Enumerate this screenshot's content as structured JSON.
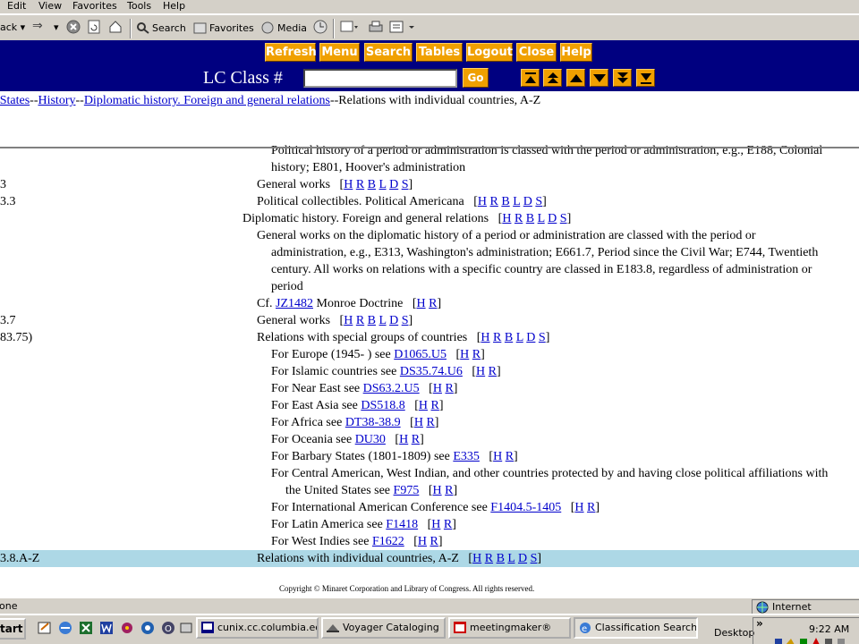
{
  "menubar": {
    "items": [
      "Edit",
      "View",
      "Favorites",
      "Tools",
      "Help"
    ]
  },
  "toolbar": {
    "back": "ack",
    "search": "Search",
    "favorites": "Favorites",
    "media": "Media"
  },
  "nav": {
    "buttons": [
      "Refresh",
      "Menu",
      "Search",
      "Tables",
      "Logout",
      "Close",
      "Help"
    ],
    "lc_label": "LC Class #",
    "lc_value": "",
    "go": "Go",
    "arrows": [
      "top-icon",
      "page-up-icon",
      "line-up-icon",
      "line-down-icon",
      "page-down-icon",
      "bottom-icon"
    ]
  },
  "breadcrumb": {
    "links": [
      "ed States",
      "History",
      "Diplomatic history. Foreign and general relations"
    ],
    "sep": "--",
    "tail": "Relations with individual countries, A-Z"
  },
  "rows": [
    {
      "cls": "",
      "caption": "Political history of a period or administration is classed with the period or administration, e.g., E188, Colonial",
      "labels": []
    },
    {
      "cls": "",
      "caption": "history; E801, Hoover's administration",
      "labels": []
    },
    {
      "cls": "3",
      "caption": "General works",
      "labels": [
        "H",
        "R",
        "B",
        "L",
        "D",
        "S"
      ]
    },
    {
      "cls": "3.3",
      "caption": "Political collectibles. Political Americana",
      "labels": [
        "H",
        "R",
        "B",
        "L",
        "D",
        "S"
      ]
    },
    {
      "cls": "",
      "caption": "Diplomatic history. Foreign and general relations",
      "labels": [
        "H",
        "R",
        "B",
        "L",
        "D",
        "S"
      ]
    },
    {
      "cls": "",
      "caption": "General works on the diplomatic history of a period or administration are classed with the period or",
      "labels": []
    },
    {
      "cls": "",
      "caption": "administration, e.g., E313, Washington's administration; E661.7, Period since the Civil War; E744, Twentieth",
      "labels": []
    },
    {
      "cls": "",
      "caption": "century. All works on relations with a specific country are classed in E183.8, regardless of administration or",
      "labels": []
    },
    {
      "cls": "",
      "caption": "period",
      "labels": []
    },
    {
      "cls": "",
      "caption": "Cf.",
      "link": "JZ1482",
      "after": "Monroe Doctrine",
      "labels": [
        "H",
        "R"
      ]
    },
    {
      "cls": "3.7",
      "caption": "General works",
      "labels": [
        "H",
        "R",
        "B",
        "L",
        "D",
        "S"
      ]
    },
    {
      "cls": "83.75)",
      "caption": "Relations with special groups of countries",
      "labels": [
        "H",
        "R",
        "B",
        "L",
        "D",
        "S"
      ]
    },
    {
      "cls": "",
      "caption": "For Europe (1945- ) see",
      "link": "D1065.U5",
      "labels": [
        "H",
        "R"
      ]
    },
    {
      "cls": "",
      "caption": "For Islamic countries see",
      "link": "DS35.74.U6",
      "labels": [
        "H",
        "R"
      ]
    },
    {
      "cls": "",
      "caption": "For Near East see",
      "link": "DS63.2.U5",
      "labels": [
        "H",
        "R"
      ]
    },
    {
      "cls": "",
      "caption": "For East Asia see",
      "link": "DS518.8",
      "labels": [
        "H",
        "R"
      ]
    },
    {
      "cls": "",
      "caption": "For Africa see",
      "link": "DT38-38.9",
      "labels": [
        "H",
        "R"
      ]
    },
    {
      "cls": "",
      "caption": "For Oceania see",
      "link": "DU30",
      "labels": [
        "H",
        "R"
      ]
    },
    {
      "cls": "",
      "caption": "For Barbary States (1801-1809) see",
      "link": "E335",
      "labels": [
        "H",
        "R"
      ]
    },
    {
      "cls": "",
      "caption": "For Central American, West Indian, and other countries protected by and having close political affiliations with",
      "labels": []
    },
    {
      "cls": "",
      "caption": "the United States see",
      "link": "F975",
      "labels": [
        "H",
        "R"
      ]
    },
    {
      "cls": "",
      "caption": "For International American Conference see",
      "link": "F1404.5-1405",
      "labels": [
        "H",
        "R"
      ]
    },
    {
      "cls": "",
      "caption": "For Latin America see",
      "link": "F1418",
      "labels": [
        "H",
        "R"
      ]
    },
    {
      "cls": "",
      "caption": "For West Indies see",
      "link": "F1622",
      "labels": [
        "H",
        "R"
      ]
    },
    {
      "cls": "3.8.A-Z",
      "caption": "Relations with individual countries, A-Z",
      "labels": [
        "H",
        "R",
        "B",
        "L",
        "D",
        "S"
      ],
      "highlight": true
    }
  ],
  "copyright": "Copyright © Minaret Corporation and Library of Congress. All rights reserved.",
  "status": {
    "text": "one",
    "zone": "Internet"
  },
  "taskbar": {
    "start": "tart",
    "tasks": [
      "cunix.cc.columbia.ed...",
      "Voyager Cataloging",
      "meetingmaker®",
      "Classification Search ..."
    ],
    "desktop": "Desktop",
    "chevron": "»",
    "time": "9:22 AM"
  },
  "colors": {
    "nav_band": "#000080",
    "nav_button": "#f0a000",
    "highlight_row": "#add8e6",
    "link": "#0000cc"
  }
}
